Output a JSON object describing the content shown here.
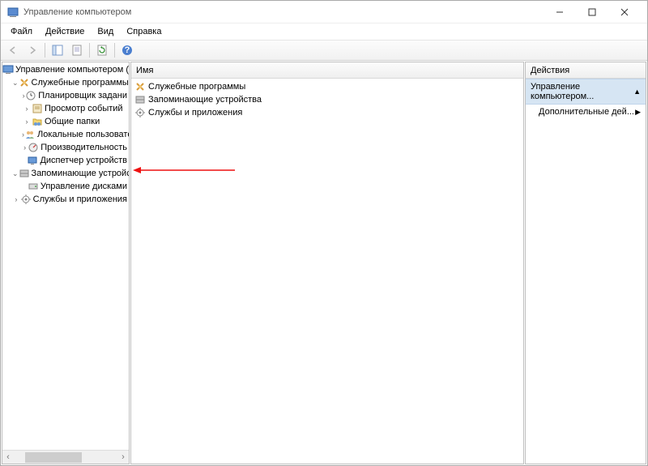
{
  "title": "Управление компьютером",
  "menu": {
    "file": "Файл",
    "action": "Действие",
    "view": "Вид",
    "help": "Справка"
  },
  "tree": {
    "root": "Управление компьютером (л",
    "sys_tools": "Служебные программы",
    "sched": "Планировщик задани",
    "eventv": "Просмотр событий",
    "shared": "Общие папки",
    "localusr": "Локальные пользовате",
    "perf": "Производительность",
    "devmgr": "Диспетчер устройств",
    "storage": "Запоминающие устройст",
    "diskmgr": "Управление дисками",
    "services": "Службы и приложения"
  },
  "mid": {
    "header": "Имя",
    "items": {
      "sys_tools": "Служебные программы",
      "storage": "Запоминающие устройства",
      "services": "Службы и приложения"
    }
  },
  "actions": {
    "header": "Действия",
    "selected": "Управление компьютером...",
    "more": "Дополнительные дей..."
  }
}
